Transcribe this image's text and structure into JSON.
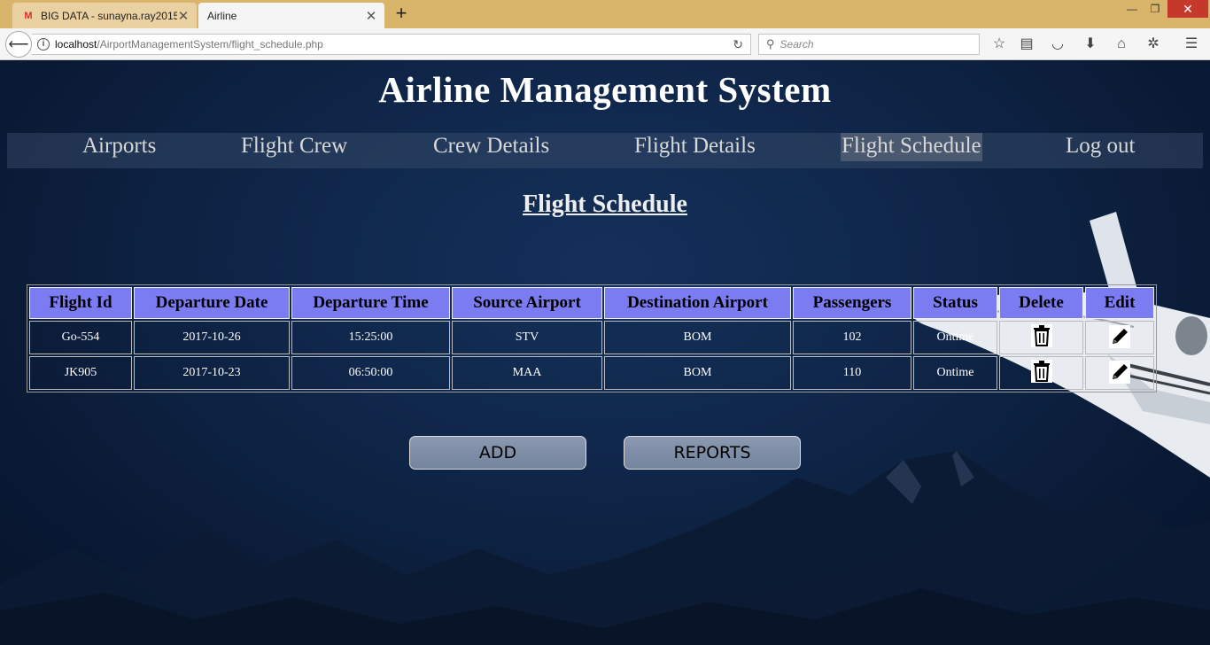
{
  "browser": {
    "tabs": [
      {
        "title": "BIG DATA - sunayna.ray2015",
        "favicon": "gmail-icon"
      },
      {
        "title": "Airline",
        "active": true
      }
    ],
    "url_host": "localhost",
    "url_path": "/AirportManagementSystem/flight_schedule.php",
    "search_placeholder": "Search"
  },
  "site": {
    "title": "Airline Management System"
  },
  "menu": {
    "items": [
      {
        "label": "Airports"
      },
      {
        "label": "Flight Crew"
      },
      {
        "label": "Crew Details"
      },
      {
        "label": "Flight Details"
      },
      {
        "label": "Flight Schedule",
        "active": true
      },
      {
        "label": "Log out"
      }
    ]
  },
  "page": {
    "heading": "Flight Schedule"
  },
  "table": {
    "headers": [
      "Flight Id",
      "Departure Date",
      "Departure Time",
      "Source Airport",
      "Destination Airport",
      "Passengers",
      "Status",
      "Delete",
      "Edit"
    ],
    "rows": [
      {
        "flight_id": "Go-554",
        "departure_date": "2017-10-26",
        "departure_time": "15:25:00",
        "source": "STV",
        "destination": "BOM",
        "passengers": "102",
        "status": "Ontime"
      },
      {
        "flight_id": "JK905",
        "departure_date": "2017-10-23",
        "departure_time": "06:50:00",
        "source": "MAA",
        "destination": "BOM",
        "passengers": "110",
        "status": "Ontime"
      }
    ]
  },
  "buttons": {
    "add": "ADD",
    "reports": "REPORTS"
  },
  "colors": {
    "header_bg": "#7b7bf2",
    "menu_active_bg": "#4a5870",
    "tabbar": "#d9b56b"
  }
}
